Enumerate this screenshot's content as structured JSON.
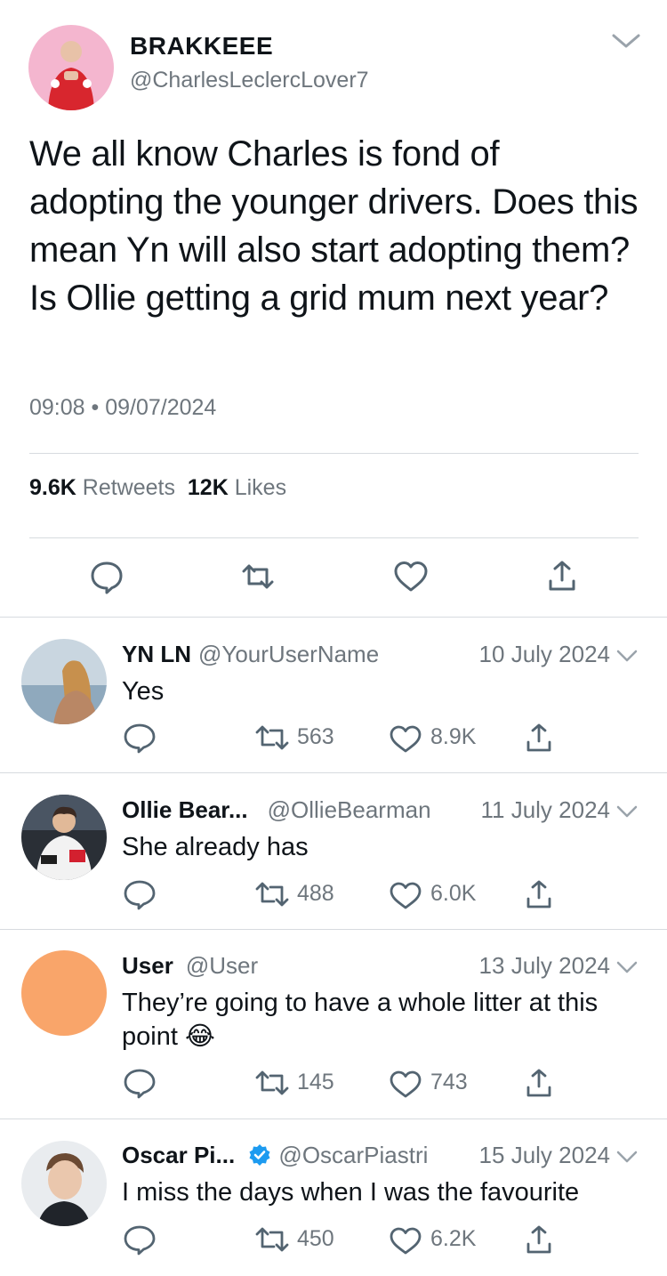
{
  "tweet": {
    "author_name": "BRAKKEEE",
    "author_handle": "@CharlesLeclercLover7",
    "text": "We all know Charles is fond of adopting the younger drivers. Does this mean Yn will also start adopting them? Is Ollie getting a grid mum next year?",
    "timestamp": "09:08 • 09/07/2024",
    "retweets_count": "9.6K",
    "retweets_label": "Retweets",
    "likes_count": "12K",
    "likes_label": "Likes"
  },
  "replies": [
    {
      "name": "YN LN",
      "handle": "@YourUserName",
      "date": "10 July 2024",
      "text": "Yes",
      "retweets": "563",
      "likes": "8.9K"
    },
    {
      "name": "Ollie Bear...",
      "handle": "@OllieBearman",
      "date": "11 July 2024",
      "text": "She already has",
      "retweets": "488",
      "likes": "6.0K"
    },
    {
      "name": "User",
      "handle": "@User",
      "date": "13 July 2024",
      "text": "They’re going to have a whole litter at this point",
      "emoji": "😂",
      "retweets": "145",
      "likes": "743"
    },
    {
      "name": "Oscar Pi...",
      "handle": "@OscarPiastri",
      "date": "15 July 2024",
      "text": "I miss the days when I was the favourite",
      "retweets": "450",
      "likes": "6.2K"
    }
  ],
  "colors": {
    "text": "#0f1419",
    "secondary": "#6e767d",
    "icon": "#536471",
    "divider": "#d7dbdf",
    "verified": "#1d9bf0",
    "orange_avatar": "#f9a56a"
  },
  "icons": [
    "chevron-down-icon",
    "reply-icon",
    "retweet-icon",
    "like-icon",
    "share-icon",
    "verified-badge-icon"
  ]
}
